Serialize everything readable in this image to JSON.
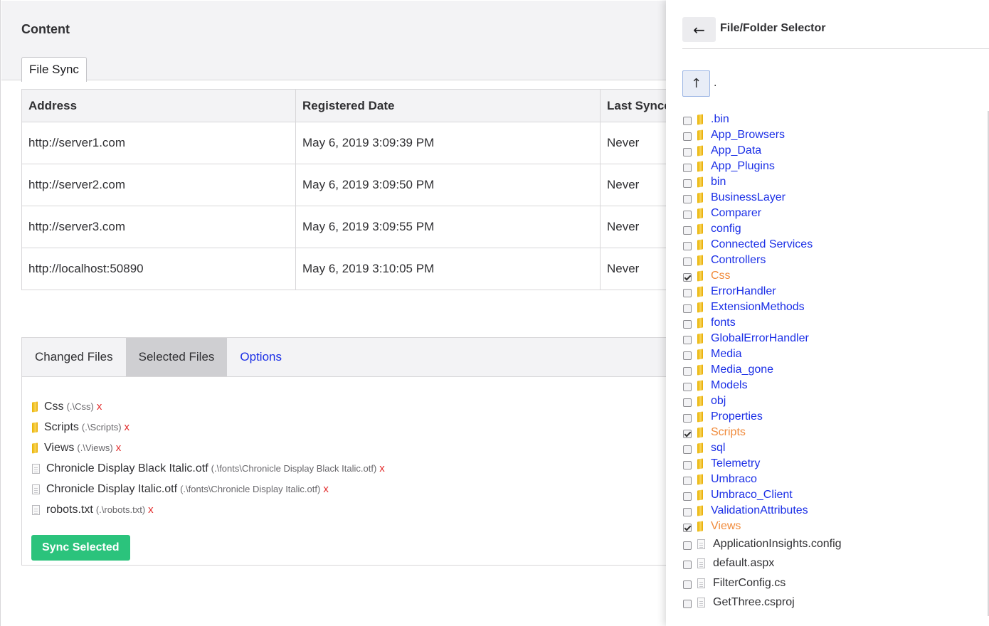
{
  "header": {
    "title": "Content",
    "tab": "File Sync"
  },
  "servers": {
    "columns": [
      "Address",
      "Registered Date",
      "Last Synced"
    ],
    "rows": [
      [
        "http://server1.com",
        "May 6, 2019 3:09:39 PM",
        "Never"
      ],
      [
        "http://server2.com",
        "May 6, 2019 3:09:50 PM",
        "Never"
      ],
      [
        "http://server3.com",
        "May 6, 2019 3:09:55 PM",
        "Never"
      ],
      [
        "http://localhost:50890",
        "May 6, 2019 3:10:05 PM",
        "Never"
      ]
    ]
  },
  "files_panel": {
    "tabs": [
      {
        "label": "Changed Files",
        "active": false,
        "link": false
      },
      {
        "label": "Selected Files",
        "active": true,
        "link": false
      },
      {
        "label": "Options",
        "active": false,
        "link": true
      }
    ],
    "selected": [
      {
        "type": "folder",
        "name": "Css",
        "path": "(.\\Css)"
      },
      {
        "type": "folder",
        "name": "Scripts",
        "path": "(.\\Scripts)"
      },
      {
        "type": "folder",
        "name": "Views",
        "path": "(.\\Views)"
      },
      {
        "type": "file",
        "name": "Chronicle Display Black Italic.otf",
        "path": "(.\\fonts\\Chronicle Display Black Italic.otf)"
      },
      {
        "type": "file",
        "name": "Chronicle Display Italic.otf",
        "path": "(.\\fonts\\Chronicle Display Italic.otf)"
      },
      {
        "type": "file",
        "name": "robots.txt",
        "path": "(.\\robots.txt)"
      }
    ],
    "remove_glyph": "x",
    "sync_label": "Sync Selected"
  },
  "selector": {
    "back_glyph": "←",
    "title": "File/Folder Selector",
    "up_glyph": "↑",
    "current_dir": ".",
    "items": [
      {
        "type": "folder",
        "name": ".bin",
        "checked": false
      },
      {
        "type": "folder",
        "name": "App_Browsers",
        "checked": false
      },
      {
        "type": "folder",
        "name": "App_Data",
        "checked": false
      },
      {
        "type": "folder",
        "name": "App_Plugins",
        "checked": false
      },
      {
        "type": "folder",
        "name": "bin",
        "checked": false
      },
      {
        "type": "folder",
        "name": "BusinessLayer",
        "checked": false
      },
      {
        "type": "folder",
        "name": "Comparer",
        "checked": false
      },
      {
        "type": "folder",
        "name": "config",
        "checked": false
      },
      {
        "type": "folder",
        "name": "Connected Services",
        "checked": false
      },
      {
        "type": "folder",
        "name": "Controllers",
        "checked": false
      },
      {
        "type": "folder",
        "name": "Css",
        "checked": true
      },
      {
        "type": "folder",
        "name": "ErrorHandler",
        "checked": false
      },
      {
        "type": "folder",
        "name": "ExtensionMethods",
        "checked": false
      },
      {
        "type": "folder",
        "name": "fonts",
        "checked": false
      },
      {
        "type": "folder",
        "name": "GlobalErrorHandler",
        "checked": false
      },
      {
        "type": "folder",
        "name": "Media",
        "checked": false
      },
      {
        "type": "folder",
        "name": "Media_gone",
        "checked": false
      },
      {
        "type": "folder",
        "name": "Models",
        "checked": false
      },
      {
        "type": "folder",
        "name": "obj",
        "checked": false
      },
      {
        "type": "folder",
        "name": "Properties",
        "checked": false
      },
      {
        "type": "folder",
        "name": "Scripts",
        "checked": true
      },
      {
        "type": "folder",
        "name": "sql",
        "checked": false
      },
      {
        "type": "folder",
        "name": "Telemetry",
        "checked": false
      },
      {
        "type": "folder",
        "name": "Umbraco",
        "checked": false
      },
      {
        "type": "folder",
        "name": "Umbraco_Client",
        "checked": false
      },
      {
        "type": "folder",
        "name": "ValidationAttributes",
        "checked": false
      },
      {
        "type": "folder",
        "name": "Views",
        "checked": true
      },
      {
        "type": "file",
        "name": "ApplicationInsights.config",
        "checked": false
      },
      {
        "type": "file",
        "name": "default.aspx",
        "checked": false
      },
      {
        "type": "file",
        "name": "FilterConfig.cs",
        "checked": false
      },
      {
        "type": "file",
        "name": "GetThree.csproj",
        "checked": false
      }
    ]
  },
  "colors": {
    "link": "#1a2ee6",
    "selected_folder": "#f08a3a",
    "sync_button": "#2bc37c",
    "remove": "#e22c2c",
    "folder_icon": "#f2c12e"
  }
}
